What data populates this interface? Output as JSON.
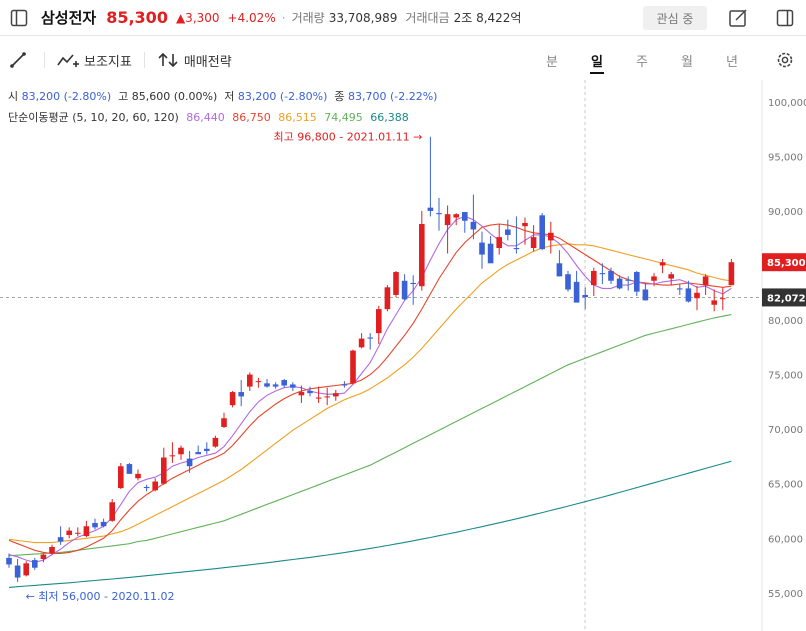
{
  "header": {
    "stock_name": "삼성전자",
    "price": "85,300",
    "change": "▲3,300",
    "change_pct": "+4.02%",
    "separator": "·",
    "volume_label": "거래량",
    "volume": "33,708,989",
    "amount_label": "거래대금",
    "amount": "2조 8,422억",
    "watch_button": "관심 중"
  },
  "toolbar": {
    "indicator_label": "보조지표",
    "strategy_label": "매매전략",
    "periods": [
      "분",
      "일",
      "주",
      "월",
      "년"
    ],
    "active_period": "일"
  },
  "ohlc": {
    "open_label": "시",
    "open": "83,200 (-2.80%)",
    "high_label": "고",
    "high": "85,600 (0.00%)",
    "low_label": "저",
    "low": "83,200 (-2.80%)",
    "close_label": "종",
    "close": "83,700 (-2.22%)"
  },
  "ma_legend": {
    "label": "단순이동평균 (5, 10, 20, 60, 120)",
    "values": [
      "86,440",
      "86,750",
      "86,515",
      "74,495",
      "66,388"
    ],
    "colors": [
      "#b46ae0",
      "#e8452c",
      "#f0a020",
      "#62b25a",
      "#1a8a8a"
    ]
  },
  "colors": {
    "up": "#e02020",
    "down": "#3a62d6",
    "crosshair_label_bg": "#333333"
  },
  "chart_data": {
    "type": "candlestick",
    "y_ticks": [
      55000,
      60000,
      65000,
      70000,
      75000,
      80000,
      85000,
      90000,
      95000,
      100000
    ],
    "y_tick_labels": [
      "55,000",
      "60,000",
      "65,000",
      "70,000",
      "75,000",
      "80,000",
      "85,000",
      "90,000",
      "95,000",
      "100,000"
    ],
    "ylim": [
      51500,
      102000
    ],
    "current_price_label": "85,300",
    "current_price": 85300,
    "crosshair_price_label": "82,072",
    "crosshair_price": 82072,
    "high_annotation": "최고 96,800 - 2021.01.11",
    "high_value": 96800,
    "low_annotation": "최저 56,000 - 2020.11.02",
    "low_value": 56000,
    "candles": [
      [
        58200,
        58600,
        57300,
        57600
      ],
      [
        57500,
        58100,
        56000,
        56400
      ],
      [
        56600,
        57900,
        56500,
        57700
      ],
      [
        58000,
        58200,
        57100,
        57300
      ],
      [
        58100,
        58600,
        57800,
        58500
      ],
      [
        58600,
        59400,
        58500,
        59200
      ],
      [
        60100,
        61100,
        59400,
        59700
      ],
      [
        60300,
        61000,
        60000,
        60700
      ],
      [
        60500,
        61000,
        60200,
        60500
      ],
      [
        60200,
        61600,
        60100,
        61100
      ],
      [
        61400,
        61800,
        60800,
        61000
      ],
      [
        61500,
        61800,
        61000,
        61100
      ],
      [
        61600,
        63600,
        61500,
        63300
      ],
      [
        64600,
        66900,
        64500,
        66600
      ],
      [
        66800,
        66900,
        66000,
        65900
      ],
      [
        65500,
        66300,
        65300,
        65900
      ],
      [
        64700,
        64900,
        64300,
        64600
      ],
      [
        64400,
        65500,
        64300,
        65200
      ],
      [
        65000,
        68300,
        64900,
        67400
      ],
      [
        67600,
        68800,
        66900,
        67600
      ],
      [
        67700,
        68500,
        67200,
        68300
      ],
      [
        67300,
        68000,
        66000,
        66600
      ],
      [
        67900,
        68500,
        67800,
        67700
      ],
      [
        68200,
        68800,
        67700,
        68000
      ],
      [
        68400,
        69400,
        68300,
        69200
      ],
      [
        70200,
        71500,
        70100,
        71000
      ],
      [
        72200,
        73500,
        72000,
        73400
      ],
      [
        73400,
        74500,
        72100,
        73000
      ],
      [
        73900,
        75200,
        73500,
        75000
      ],
      [
        74400,
        74700,
        73800,
        74400
      ],
      [
        74200,
        74600,
        73800,
        73900
      ],
      [
        74100,
        74300,
        73700,
        73900
      ],
      [
        74500,
        74600,
        73800,
        74000
      ],
      [
        74100,
        74300,
        73500,
        73800
      ],
      [
        73100,
        74000,
        72400,
        73400
      ],
      [
        73500,
        73900,
        73000,
        73300
      ],
      [
        72800,
        73900,
        72400,
        72900
      ],
      [
        73000,
        73800,
        72200,
        73000
      ],
      [
        73000,
        73600,
        72600,
        73300
      ],
      [
        74100,
        74400,
        73800,
        74000
      ],
      [
        74200,
        77300,
        74100,
        77200
      ],
      [
        77500,
        78800,
        77400,
        78300
      ],
      [
        78400,
        78800,
        77300,
        78300
      ],
      [
        78800,
        81300,
        77800,
        81000
      ],
      [
        81000,
        83200,
        80800,
        83000
      ],
      [
        82300,
        84500,
        82100,
        84400
      ],
      [
        83600,
        84200,
        81800,
        81900
      ],
      [
        83400,
        84100,
        81400,
        83300
      ],
      [
        83100,
        90000,
        82700,
        88800
      ],
      [
        90300,
        96800,
        89500,
        90000
      ],
      [
        89800,
        91200,
        88200,
        89700
      ],
      [
        88700,
        90500,
        86100,
        89700
      ],
      [
        89400,
        89800,
        88700,
        89700
      ],
      [
        89900,
        89900,
        88000,
        89100
      ],
      [
        89000,
        91500,
        87400,
        88300
      ],
      [
        87100,
        88100,
        84700,
        86000
      ],
      [
        87000,
        87700,
        85400,
        85200
      ],
      [
        86600,
        88800,
        86000,
        87600
      ],
      [
        88300,
        89200,
        87300,
        87800
      ],
      [
        86600,
        89500,
        86100,
        86500
      ],
      [
        88600,
        89400,
        86900,
        88900
      ],
      [
        86600,
        88700,
        86300,
        87600
      ],
      [
        89600,
        89800,
        86400,
        86500
      ],
      [
        87300,
        89000,
        86100,
        88000
      ],
      [
        85200,
        86400,
        84000,
        84000
      ],
      [
        84200,
        84500,
        82600,
        82800
      ],
      [
        83500,
        84500,
        81600,
        81600
      ],
      [
        82300,
        83000,
        81000,
        82100
      ],
      [
        83200,
        84800,
        82200,
        84500
      ],
      [
        84300,
        85200,
        83300,
        84200
      ],
      [
        84500,
        84800,
        83300,
        83600
      ],
      [
        83800,
        84100,
        82800,
        82900
      ],
      [
        83700,
        84000,
        82700,
        83600
      ],
      [
        84400,
        84500,
        82200,
        82600
      ],
      [
        82800,
        83400,
        81800,
        81800
      ],
      [
        83600,
        84300,
        83100,
        84000
      ],
      [
        85000,
        85600,
        84300,
        85300
      ],
      [
        83800,
        84400,
        83200,
        84200
      ],
      [
        82900,
        83300,
        82300,
        82800
      ],
      [
        82900,
        83600,
        81600,
        81700
      ],
      [
        82000,
        83100,
        80900,
        82500
      ],
      [
        83200,
        84200,
        82300,
        84000
      ],
      [
        81400,
        82800,
        80800,
        81800
      ],
      [
        82000,
        83000,
        80900,
        82000
      ],
      [
        83200,
        85600,
        83200,
        85300
      ]
    ],
    "ma5": [
      58500,
      58300,
      58000,
      57800,
      58000,
      58500,
      59000,
      59600,
      60100,
      60400,
      60700,
      61100,
      61900,
      63100,
      64300,
      65100,
      65400,
      65600,
      66000,
      66600,
      66900,
      67100,
      67400,
      67600,
      67800,
      68400,
      69400,
      70500,
      71600,
      72500,
      73100,
      73500,
      73800,
      73900,
      73800,
      73500,
      73300,
      73200,
      73200,
      73300,
      74100,
      75100,
      76100,
      77600,
      79200,
      80500,
      81800,
      82700,
      83900,
      85500,
      87000,
      88300,
      89200,
      89500,
      89200,
      88600,
      87900,
      87300,
      86800,
      86800,
      87300,
      87800,
      87800,
      87600,
      87000,
      86100,
      85000,
      84000,
      83200,
      82900,
      82900,
      83200,
      83200,
      83500,
      83300,
      83300,
      83500,
      83600,
      83700,
      83400,
      83000,
      83100,
      82700,
      82400,
      82900
    ],
    "ma10": [
      59800,
      59500,
      59200,
      58900,
      58700,
      58600,
      58600,
      58700,
      58900,
      59200,
      59600,
      60000,
      60700,
      61700,
      62600,
      63400,
      64000,
      64500,
      65000,
      65500,
      65900,
      66300,
      66700,
      67100,
      67400,
      67800,
      68500,
      69400,
      70300,
      71100,
      71700,
      72300,
      72800,
      73200,
      73500,
      73700,
      73800,
      73900,
      74000,
      74100,
      74200,
      74500,
      75000,
      75700,
      76600,
      77600,
      78600,
      79700,
      81000,
      82400,
      83800,
      85000,
      86200,
      87100,
      87800,
      88500,
      88700,
      88800,
      88700,
      88500,
      88200,
      88000,
      87900,
      87800,
      87500,
      87000,
      86500,
      86000,
      85500,
      85000,
      84500,
      84000,
      83700,
      83500,
      83400,
      83300,
      83200,
      83200,
      83300,
      83400,
      83300,
      83200,
      83100,
      83000,
      83100
    ],
    "ma20": [
      59900,
      59800,
      59700,
      59600,
      59600,
      59600,
      59700,
      59800,
      59900,
      60000,
      60100,
      60200,
      60400,
      60600,
      60900,
      61300,
      61700,
      62100,
      62500,
      62900,
      63300,
      63700,
      64100,
      64500,
      64900,
      65300,
      65800,
      66300,
      66900,
      67500,
      68100,
      68700,
      69300,
      69900,
      70400,
      70900,
      71400,
      71900,
      72300,
      72700,
      73000,
      73300,
      73700,
      74200,
      74700,
      75300,
      75900,
      76600,
      77400,
      78300,
      79200,
      80100,
      81000,
      81800,
      82600,
      83400,
      84000,
      84600,
      85100,
      85500,
      85900,
      86300,
      86600,
      86800,
      86900,
      87000,
      86900,
      86900,
      86800,
      86600,
      86400,
      86200,
      86000,
      85800,
      85600,
      85400,
      85200,
      85000,
      84800,
      84600,
      84300,
      84100,
      83900,
      83700,
      83600
    ],
    "ma60": [
      58400,
      58450,
      58500,
      58550,
      58600,
      58650,
      58700,
      58800,
      58900,
      59000,
      59100,
      59200,
      59300,
      59400,
      59500,
      59700,
      59800,
      60000,
      60200,
      60400,
      60600,
      60800,
      61000,
      61200,
      61400,
      61600,
      61900,
      62200,
      62500,
      62800,
      63100,
      63400,
      63700,
      64000,
      64300,
      64600,
      64900,
      65200,
      65500,
      65800,
      66100,
      66400,
      66700,
      67100,
      67500,
      67900,
      68300,
      68700,
      69100,
      69500,
      69900,
      70300,
      70700,
      71100,
      71500,
      71900,
      72300,
      72700,
      73100,
      73500,
      73900,
      74300,
      74700,
      75100,
      75500,
      75900,
      76200,
      76500,
      76800,
      77100,
      77400,
      77700,
      78000,
      78300,
      78600,
      78800,
      79000,
      79200,
      79400,
      79600,
      79800,
      80000,
      80200,
      80350,
      80500
    ],
    "ma120": [
      55500,
      55560,
      55620,
      55680,
      55740,
      55800,
      55860,
      55920,
      55990,
      56060,
      56130,
      56200,
      56270,
      56340,
      56410,
      56490,
      56570,
      56650,
      56730,
      56810,
      56890,
      56970,
      57050,
      57130,
      57210,
      57300,
      57390,
      57480,
      57570,
      57660,
      57750,
      57850,
      57950,
      58050,
      58150,
      58250,
      58360,
      58470,
      58580,
      58690,
      58810,
      58940,
      59070,
      59200,
      59340,
      59480,
      59620,
      59770,
      59920,
      60070,
      60230,
      60390,
      60550,
      60720,
      60890,
      61060,
      61240,
      61420,
      61600,
      61780,
      61970,
      62160,
      62350,
      62550,
      62750,
      62950,
      63150,
      63350,
      63560,
      63770,
      63980,
      64200,
      64420,
      64640,
      64860,
      65080,
      65300,
      65520,
      65740,
      65960,
      66180,
      66400,
      66620,
      66840,
      67060
    ]
  }
}
